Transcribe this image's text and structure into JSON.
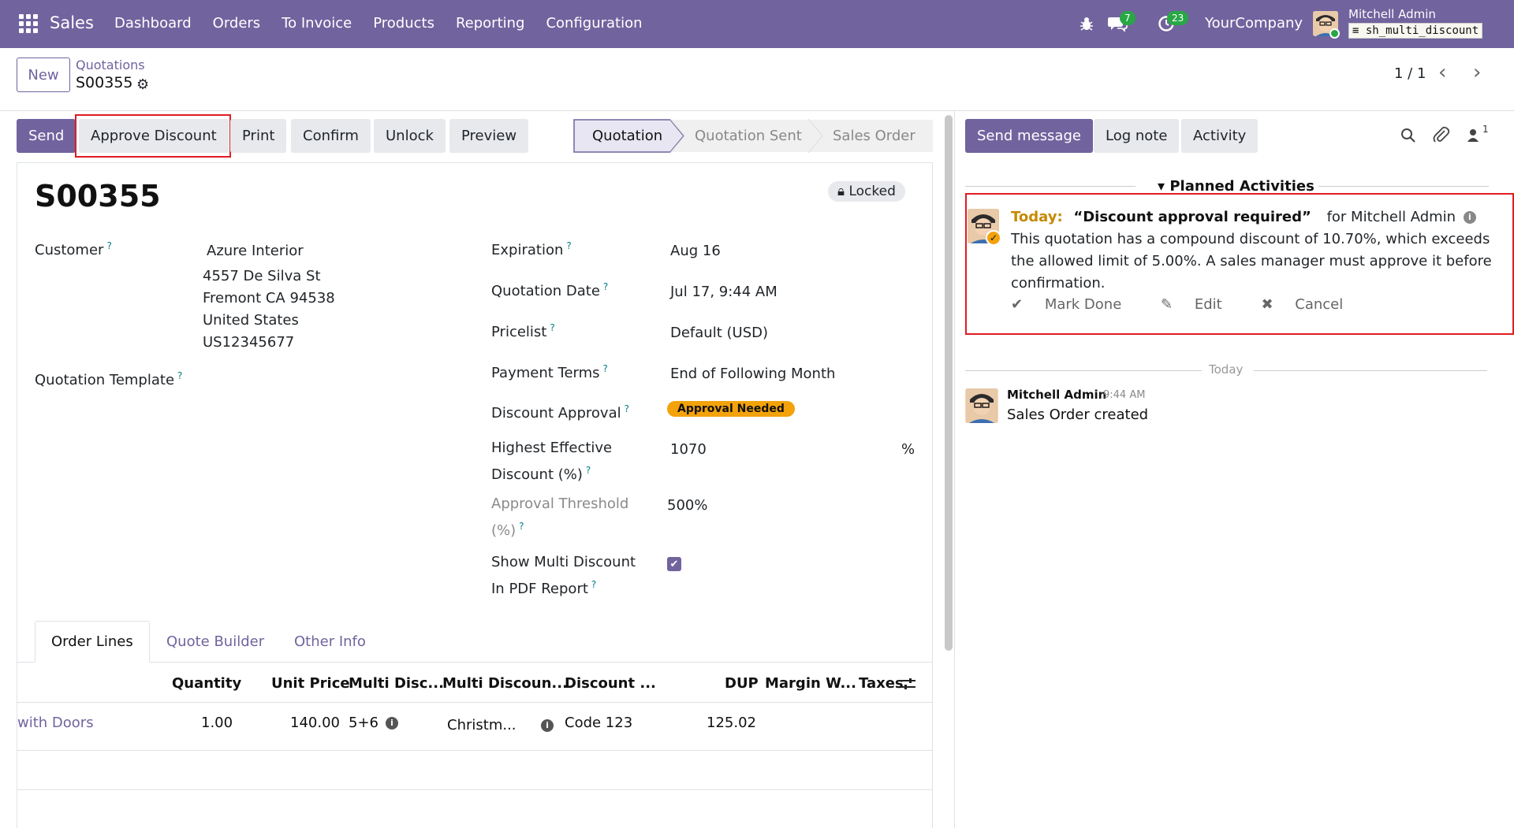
{
  "navbar": {
    "brand": "Sales",
    "menu": [
      "Dashboard",
      "Orders",
      "To Invoice",
      "Products",
      "Reporting",
      "Configuration"
    ],
    "messages_count": "7",
    "activities_count": "23",
    "company": "YourCompany",
    "user_name": "Mitchell Admin",
    "database": "sh_multi_discount"
  },
  "control_panel": {
    "new_label": "New",
    "breadcrumb_parent": "Quotations",
    "record_name": "S00355",
    "pager": "1 / 1"
  },
  "actions": {
    "send": "Send",
    "approve_discount": "Approve Discount",
    "print": "Print",
    "confirm": "Confirm",
    "unlock": "Unlock",
    "preview": "Preview"
  },
  "stages": {
    "quotation": "Quotation",
    "quotation_sent": "Quotation Sent",
    "sales_order": "Sales Order"
  },
  "form": {
    "title": "S00355",
    "locked": "Locked",
    "customer_label": "Customer",
    "customer_name": "Azure Interior",
    "address_line1": "4557 De Silva St",
    "address_line2": "Fremont CA 94538",
    "address_line3": "United States",
    "address_line4": "US12345677",
    "template_label": "Quotation Template",
    "expiration_label": "Expiration",
    "expiration_value": "Aug 16",
    "quotation_date_label": "Quotation Date",
    "quotation_date_value": "Jul 17, 9:44 AM",
    "pricelist_label": "Pricelist",
    "pricelist_value": "Default (USD)",
    "payment_terms_label": "Payment Terms",
    "payment_terms_value": "End of Following Month",
    "discount_approval_label": "Discount Approval",
    "discount_approval_value": "Approval Needed",
    "highest_discount_label_1": "Highest Effective",
    "highest_discount_label_2": "Discount (%)",
    "highest_discount_value": "1070",
    "highest_discount_unit": "%",
    "threshold_label_1": "Approval Threshold",
    "threshold_label_2": "(%)",
    "threshold_value": "500%",
    "show_multi_label_1": "Show Multi Discount",
    "show_multi_label_2": "In PDF Report",
    "show_multi_checked": true
  },
  "tabs": [
    "Order Lines",
    "Quote Builder",
    "Other Info"
  ],
  "order_lines": {
    "headers": [
      "Quantity",
      "Unit Price",
      "Multi Disc...",
      "Multi Discoun...",
      "Discount ...",
      "DUP",
      "Margin W...",
      "Taxes"
    ],
    "rows": [
      {
        "product": "with Doors",
        "quantity": "1.00",
        "unit_price": "140.00",
        "multi_disc": "5+6",
        "multi_discount_name": "Christm...",
        "discount_code": "Code 123",
        "dup": "125.02"
      }
    ]
  },
  "chatter": {
    "send_message": "Send message",
    "log_note": "Log note",
    "activity": "Activity",
    "followers_count": "1",
    "planned_activities": "Planned Activities",
    "activity_today": "Today:",
    "activity_summary": "“Discount approval required”",
    "activity_for": "for Mitchell Admin",
    "activity_note": "This quotation has a compound discount of 10.70%, which exceeds the allowed limit of 5.00%. A sales manager must approve it before confirmation.",
    "mark_done": "Mark Done",
    "edit": "Edit",
    "cancel": "Cancel",
    "separator_today": "Today",
    "message_author": "Mitchell Admin",
    "message_time": "9:44 AM",
    "message_body": "Sales Order created"
  },
  "colors": {
    "brand": "#71639e",
    "highlight": "#e11b22",
    "badge": "#28a745",
    "approval_pill": "#f3a20b"
  }
}
